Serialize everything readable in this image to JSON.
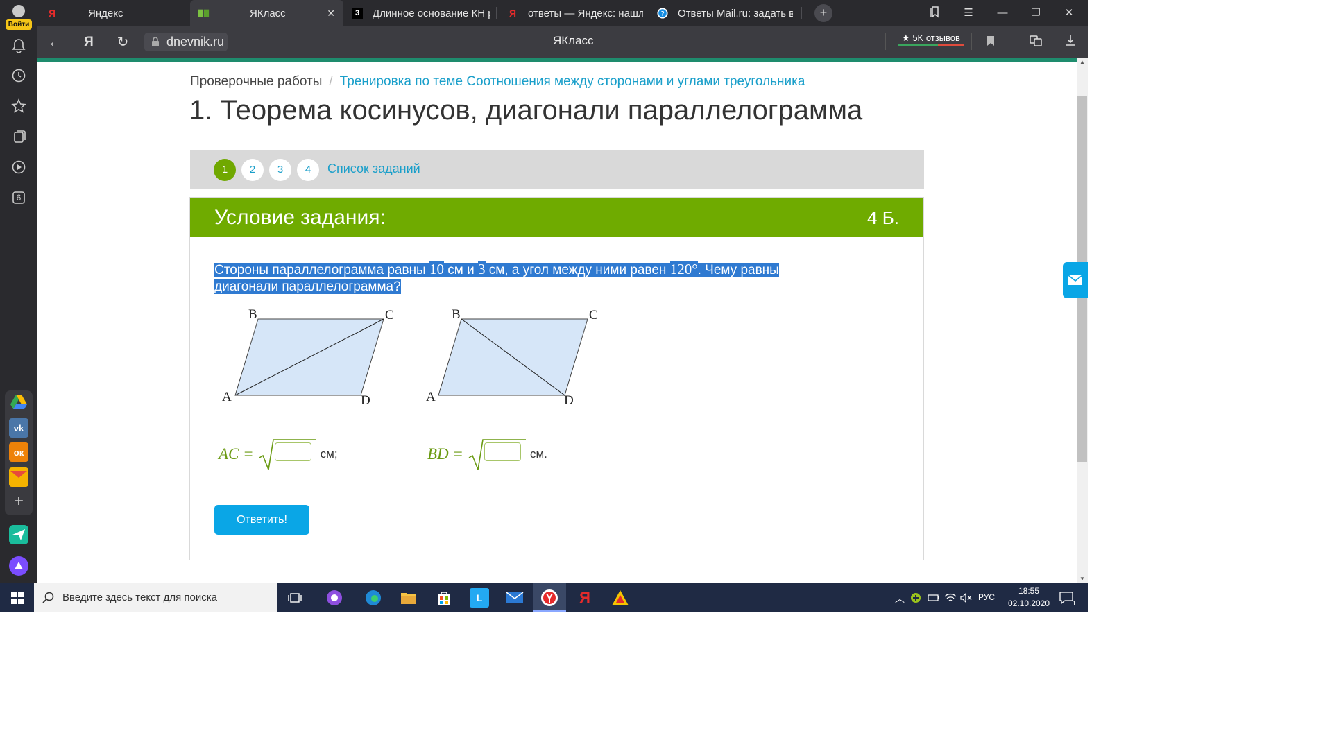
{
  "sidebar": {
    "login_label": "Войти",
    "notification_count": "6"
  },
  "tabs": [
    {
      "label": "Яндекс",
      "icon": "yandex-icon",
      "color": "#e52b2b"
    },
    {
      "label": "ЯКласс",
      "icon": "yaklass-icon",
      "color": "#7cc242",
      "active": true
    },
    {
      "label": "Длинное основание КН р",
      "icon": "znanija-icon"
    },
    {
      "label": "ответы — Яндекс: нашлос",
      "icon": "yandex-icon",
      "color": "#e52b2b"
    },
    {
      "label": "Ответы Mail.ru: задать во",
      "icon": "mailru-answers-icon"
    }
  ],
  "addressbar": {
    "url": "dnevnik.ru",
    "page_title": "ЯКласс",
    "reviews_label": "★ 5K отзывов"
  },
  "breadcrumb": {
    "parent": "Проверочные работы",
    "separator": "/",
    "current": "Тренировка по теме Соотношения между сторонами и углами треугольника"
  },
  "page_title": "1. Теорема косинусов, диагонали параллелограмма",
  "steps": {
    "items": [
      "1",
      "2",
      "3",
      "4"
    ],
    "active": "1",
    "list_link": "Список заданий"
  },
  "task": {
    "header": "Условие задания:",
    "points": "4 Б.",
    "question": {
      "part1": "Стороны параллелограмма равны ",
      "side1": "10",
      "part2": " см и ",
      "side2": "3",
      "part3": " см, а угол между ними равен ",
      "angle": "120°",
      "part4": ". Чему равны диагонали параллелограмма?"
    },
    "figure_labels": {
      "left": {
        "A": "A",
        "B": "B",
        "C": "C",
        "D": "D"
      },
      "right": {
        "A": "A",
        "B": "B",
        "C": "C",
        "D": "D"
      }
    },
    "answers": [
      {
        "lhs": "AC =",
        "value": "",
        "unit": "см;"
      },
      {
        "lhs": "BD =",
        "value": "",
        "unit": "см."
      }
    ],
    "submit_label": "Ответить!"
  },
  "taskbar": {
    "search_placeholder": "Введите здесь текст для поиска",
    "lang": "РУС",
    "time": "18:55",
    "date": "02.10.2020",
    "notifications": "1"
  },
  "colors": {
    "accent_green": "#6fab00",
    "link_blue": "#1a9fca",
    "button_blue": "#0aa6e6",
    "selection": "#2f7ad1"
  }
}
